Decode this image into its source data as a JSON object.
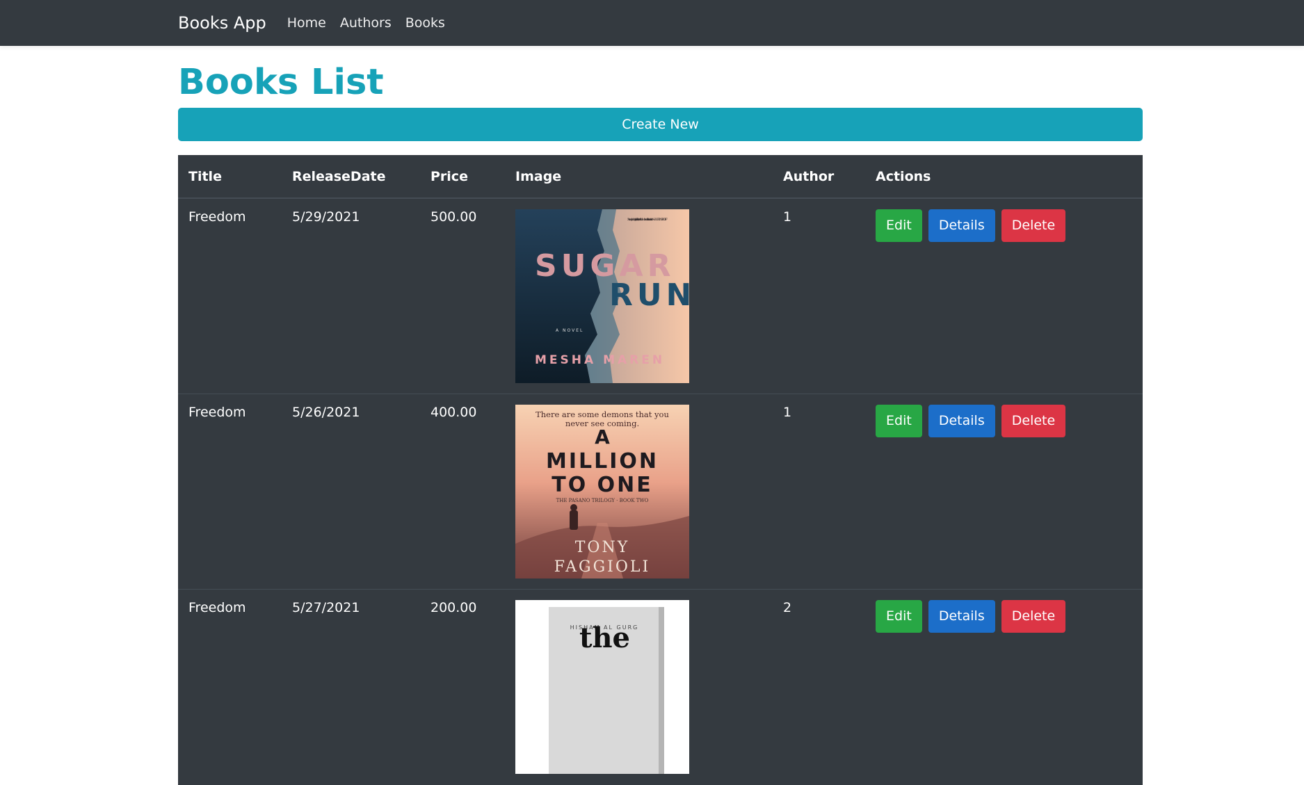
{
  "navbar": {
    "brand": "Books App",
    "links": [
      {
        "label": "Home"
      },
      {
        "label": "Authors"
      },
      {
        "label": "Books"
      }
    ]
  },
  "page": {
    "title": "Books List",
    "create_button": "Create New"
  },
  "table": {
    "headers": {
      "title": "Title",
      "release_date": "ReleaseDate",
      "price": "Price",
      "image": "Image",
      "author": "Author",
      "actions": "Actions"
    },
    "rows": [
      {
        "title": "Freedom",
        "release_date": "5/29/2021",
        "price": "500.00",
        "author": "1",
        "cover": {
          "blurb": "\"A heady admixture of ... grit and lush, lucent ... Mesha Maren writes like a force of nature.\" —LAUREN GROFF",
          "title_line_1": "SUGAR",
          "title_line_2": "RUN",
          "subtitle": "A NOVEL",
          "author": "MESHA MAREN"
        },
        "edit_label": "Edit",
        "details_label": "Details",
        "delete_label": "Delete"
      },
      {
        "title": "Freedom",
        "release_date": "5/26/2021",
        "price": "400.00",
        "author": "1",
        "cover": {
          "tagline_1": "There are some demons that you",
          "tagline_2": "never see coming.",
          "title_line_1": "A",
          "title_line_2": "MILLION",
          "title_line_3": "TO ONE",
          "series": "THE PASANO TRILOGY · BOOK TWO",
          "author_line_1": "TONY",
          "author_line_2": "FAGGIOLI"
        },
        "edit_label": "Edit",
        "details_label": "Details",
        "delete_label": "Delete"
      },
      {
        "title": "Freedom",
        "release_date": "5/27/2021",
        "price": "200.00",
        "author": "2",
        "cover": {
          "author": "HISHAM AL GURG",
          "title_fragment": "the"
        },
        "edit_label": "Edit",
        "details_label": "Details",
        "delete_label": "Delete"
      }
    ]
  },
  "colors": {
    "navbar": "#343a40",
    "accent": "#17a2b8",
    "table_bg": "#343a40",
    "edit": "#28a745",
    "details": "#1c6ec9",
    "delete": "#dc3545"
  }
}
